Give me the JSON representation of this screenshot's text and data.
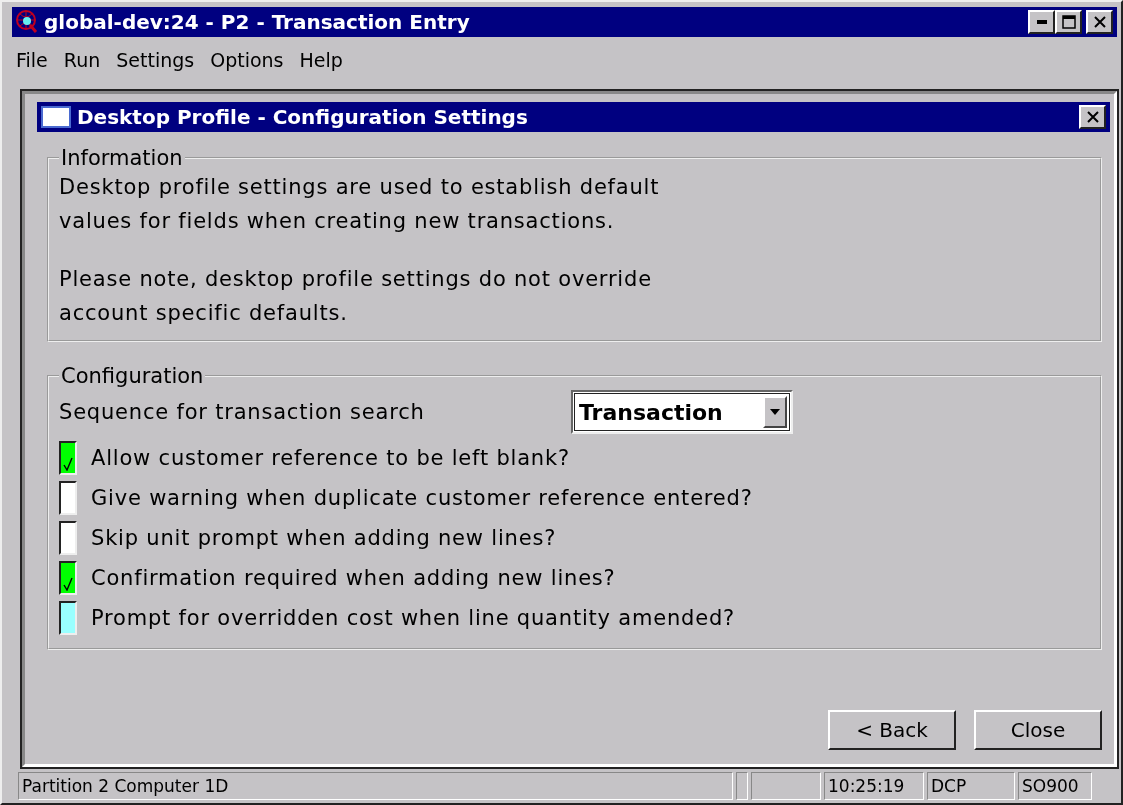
{
  "window": {
    "title": "global-dev:24 - P2 - Transaction Entry"
  },
  "menu": [
    "File",
    "Run",
    "Settings",
    "Options",
    "Help"
  ],
  "dialog": {
    "title": "Desktop Profile - Configuration Settings",
    "information": {
      "legend": "Information",
      "paragraphs": [
        "Desktop profile settings are used to establish default values for fields when creating new transactions.",
        "Please note, desktop profile settings do not override account specific defaults."
      ]
    },
    "configuration": {
      "legend": "Configuration",
      "sequence_label": "Sequence for transaction search",
      "sequence_value": "Transaction",
      "options": [
        {
          "label": "Allow customer reference to be left blank?",
          "checked": true,
          "focused": false
        },
        {
          "label": "Give warning when duplicate customer reference entered?",
          "checked": false,
          "focused": false
        },
        {
          "label": "Skip unit prompt when adding new lines?",
          "checked": false,
          "focused": false
        },
        {
          "label": "Confirmation required when adding new lines?",
          "checked": true,
          "focused": false
        },
        {
          "label": "Prompt for overridden cost when line quantity amended?",
          "checked": false,
          "focused": true
        }
      ]
    },
    "buttons": [
      "< Back",
      "Close"
    ]
  },
  "status_bar": {
    "message": "Partition 2 Computer 1D",
    "time": "10:25:19",
    "mode": "DCP",
    "program": "SO900"
  }
}
